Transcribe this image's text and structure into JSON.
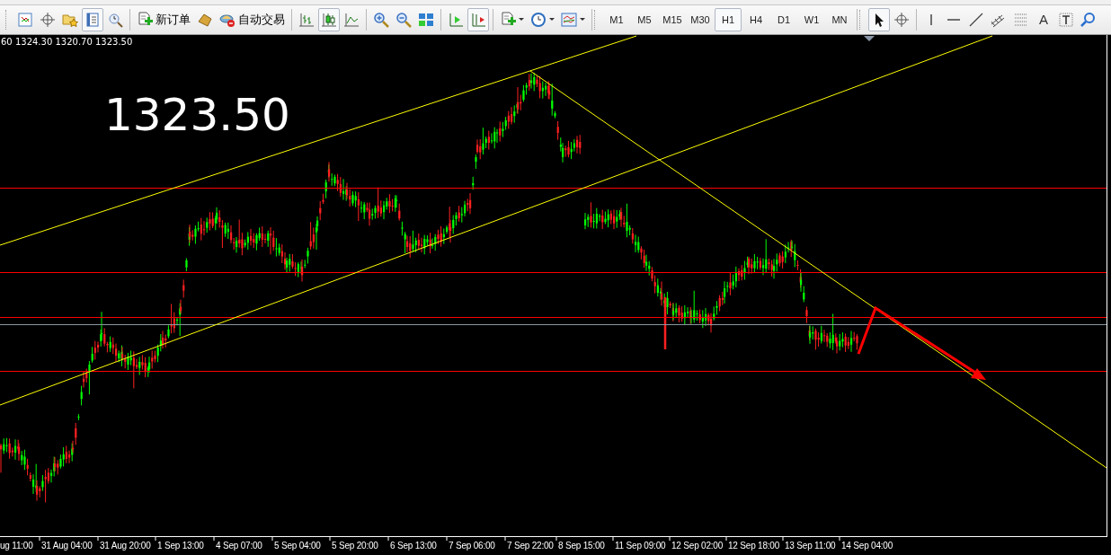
{
  "toolbar_groups": [
    [
      {
        "kind": "new-chart",
        "selected": false
      },
      {
        "kind": "crosshair",
        "selected": false
      },
      {
        "kind": "folder-star",
        "selected": false
      },
      {
        "kind": "navigator",
        "selected": true
      },
      {
        "kind": "tester",
        "selected": false
      }
    ],
    [
      {
        "kind": "new-order",
        "label": "新订单",
        "selected": false
      },
      {
        "kind": "expert",
        "selected": false
      },
      {
        "kind": "auto-trading",
        "label": "自动交易",
        "selected": false
      }
    ],
    [
      {
        "kind": "bar-chart",
        "selected": false
      },
      {
        "kind": "candles",
        "selected": true
      },
      {
        "kind": "line-chart",
        "selected": false
      }
    ],
    [
      {
        "kind": "zoom-in",
        "selected": false
      },
      {
        "kind": "zoom-out",
        "selected": false
      },
      {
        "kind": "tile",
        "selected": false
      }
    ],
    [
      {
        "kind": "autoscroll",
        "selected": false
      },
      {
        "kind": "chart-shift",
        "selected": true
      }
    ],
    [
      {
        "kind": "indicators",
        "selected": false,
        "menu": true
      },
      {
        "kind": "periods",
        "selected": false,
        "menu": true
      },
      {
        "kind": "templates",
        "selected": false,
        "menu": true
      }
    ]
  ],
  "timeframes": [
    {
      "label": "M1",
      "selected": false
    },
    {
      "label": "M5",
      "selected": false
    },
    {
      "label": "M15",
      "selected": false
    },
    {
      "label": "M30",
      "selected": false
    },
    {
      "label": "H1",
      "selected": true
    },
    {
      "label": "H4",
      "selected": false
    },
    {
      "label": "D1",
      "selected": false
    },
    {
      "label": "W1",
      "selected": false
    },
    {
      "label": "MN",
      "selected": false
    }
  ],
  "draw_tools": [
    [
      {
        "kind": "cursor",
        "selected": true
      },
      {
        "kind": "crosshair",
        "selected": false
      }
    ],
    [
      {
        "kind": "vline",
        "selected": false
      },
      {
        "kind": "hline",
        "selected": false
      },
      {
        "kind": "trendline",
        "selected": false
      },
      {
        "kind": "channel",
        "selected": false
      },
      {
        "kind": "fibo",
        "selected": false
      },
      {
        "kind": "text",
        "label": "A",
        "selected": false
      },
      {
        "kind": "text-label",
        "selected": false
      },
      {
        "kind": "search",
        "selected": false
      }
    ]
  ],
  "chart": {
    "info": "60 1324.30 1320.70 1323.50",
    "price": "1323.50",
    "time_labels": [
      "ug 11:00",
      "31 Aug 04:00",
      "31 Aug 20:00",
      "1 Sep 13:00",
      "4 Sep 07:00",
      "5 Sep 04:00",
      "5 Sep 20:00",
      "6 Sep 13:00",
      "7 Sep 06:00",
      "7 Sep 22:00",
      "8 Sep 15:00",
      "11 Sep 09:00",
      "12 Sep 02:00",
      "12 Sep 18:00",
      "13 Sep 11:00",
      "14 Sep 04:00"
    ]
  }
}
